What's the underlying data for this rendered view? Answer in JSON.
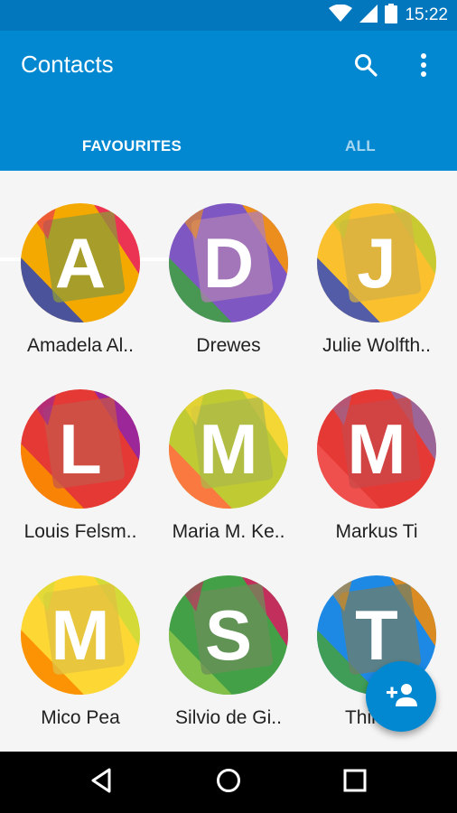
{
  "status": {
    "time": "15:22"
  },
  "appbar": {
    "title": "Contacts"
  },
  "tabs": [
    {
      "label": "FAVOURITES"
    },
    {
      "label": "ALL"
    }
  ],
  "contacts": [
    {
      "name": "Amadela Al..",
      "initial": "A",
      "colors": [
        "#f4a900",
        "#3949ab",
        "#e91e63",
        "#8d9a3a"
      ]
    },
    {
      "name": "Drewes",
      "initial": "D",
      "colors": [
        "#7e57c2",
        "#43a047",
        "#ff9800",
        "#b07fb6"
      ]
    },
    {
      "name": "Julie Wolfth..",
      "initial": "J",
      "colors": [
        "#fbc02d",
        "#3f51b5",
        "#c0ca33",
        "#d4b046"
      ]
    },
    {
      "name": "Louis Felsm..",
      "initial": "L",
      "colors": [
        "#e53935",
        "#fb8c00",
        "#8e24aa",
        "#c7574a"
      ]
    },
    {
      "name": "Maria M. Ke..",
      "initial": "M",
      "colors": [
        "#c0ca33",
        "#ff7043",
        "#fdd835",
        "#aeb84a"
      ]
    },
    {
      "name": "Markus Ti",
      "initial": "M",
      "colors": [
        "#e53935",
        "#ef5350",
        "#8e6fa8",
        "#c94848"
      ]
    },
    {
      "name": "Mico Pea",
      "initial": "M",
      "colors": [
        "#fdd835",
        "#fb8c00",
        "#cddc39",
        "#e0c040"
      ]
    },
    {
      "name": "Silvio de Gi..",
      "initial": "S",
      "colors": [
        "#43a047",
        "#8bc34a",
        "#d81b60",
        "#6b8f5a"
      ]
    },
    {
      "name": "Thimo..",
      "initial": "T",
      "colors": [
        "#1e88e5",
        "#43a047",
        "#fb8c00",
        "#6f7d6a"
      ]
    }
  ],
  "fab": {
    "icon": "add-person-icon"
  },
  "nav": {
    "back_icon": "back-icon",
    "home_icon": "home-icon",
    "recents_icon": "recents-icon"
  }
}
